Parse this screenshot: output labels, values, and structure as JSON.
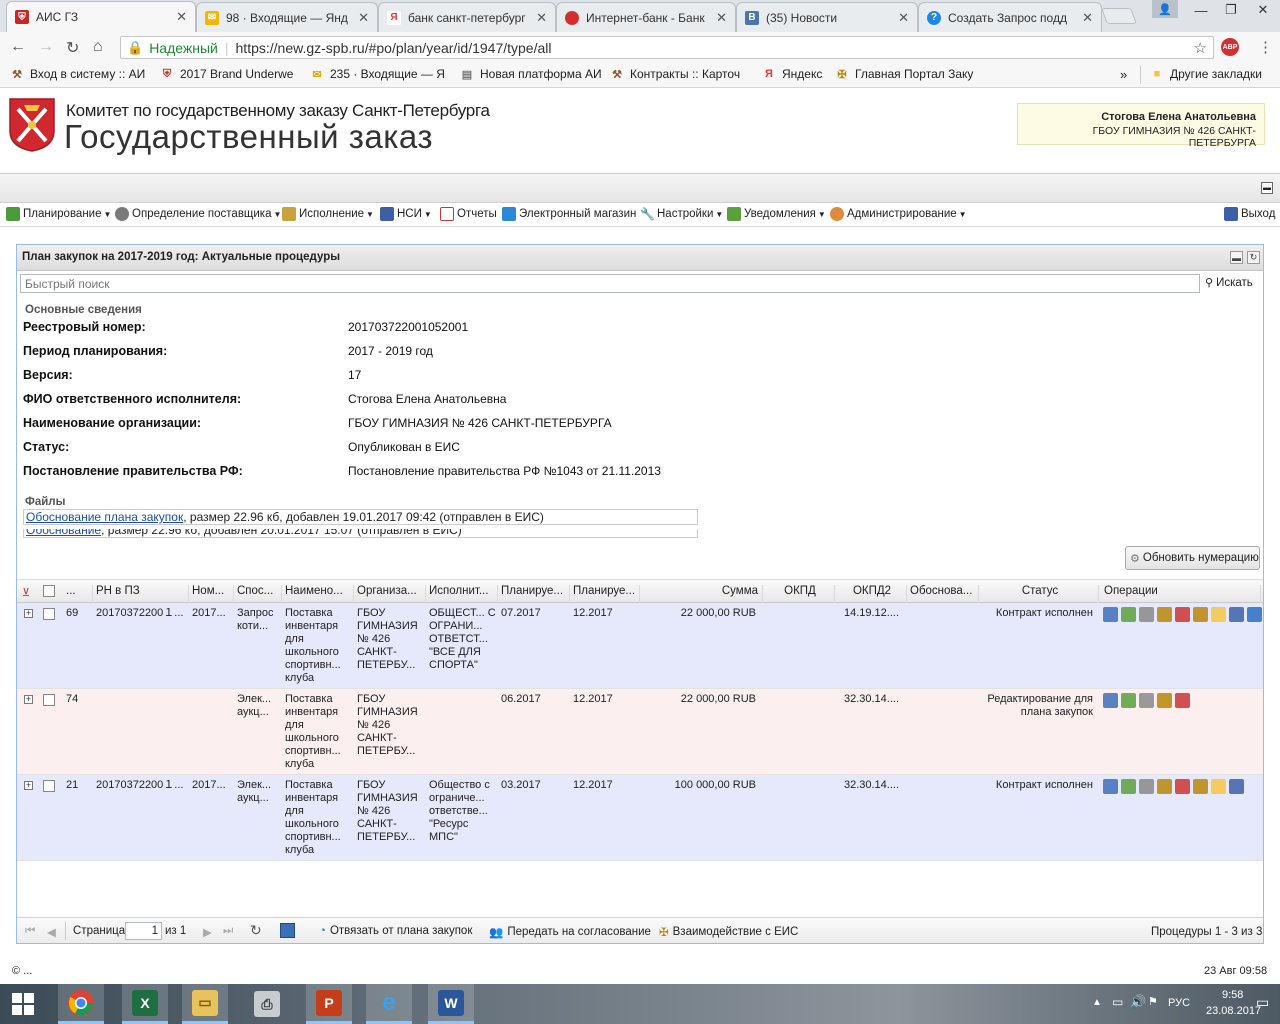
{
  "browser": {
    "tabs": [
      {
        "title": "АИС ГЗ",
        "color": "#c62828",
        "glyph": "⛨",
        "active": true
      },
      {
        "title": "98 · Входящие — Янд",
        "color": "#f2b705",
        "glyph": "✉",
        "active": false
      },
      {
        "title": "банк санкт-петербург",
        "color": "#e53935",
        "glyph": "Я",
        "active": false
      },
      {
        "title": "Интернет-банк - Банк",
        "color": "#d32f2f",
        "glyph": "●",
        "active": false
      },
      {
        "title": "(35) Новости",
        "color": "#4a76a8",
        "glyph": "В",
        "active": false
      },
      {
        "title": "Создать Запрос подд",
        "color": "#1e88e5",
        "glyph": "?",
        "active": false
      }
    ],
    "secure_label": "Надежный",
    "url": "https://new.gz-spb.ru/#po/plan/year/id/1947/type/all",
    "abp_label": "ABP",
    "bookmarks": [
      {
        "label": "Вход в систему :: АИ",
        "icon": "tools-icon"
      },
      {
        "label": "2017 Brand Underwe",
        "icon": "shield-icon"
      },
      {
        "label": "235 · Входящие — Я",
        "icon": "mail-icon"
      },
      {
        "label": "Новая платформа АИ",
        "icon": "doc-icon"
      },
      {
        "label": "Контракты :: Карточ",
        "icon": "tools-icon"
      },
      {
        "label": "Яндекс",
        "icon": "yandex-icon"
      },
      {
        "label": "Главная Портал Заку",
        "icon": "emblem-icon"
      }
    ],
    "more_bookmarks": "»",
    "other_bookmarks": "Другие закладки"
  },
  "header": {
    "org_line": "Комитет по государственному заказу Санкт-Петербурга",
    "title": "Государственный заказ",
    "user_name": "Стогова Елена Анатольевна",
    "user_org": "ГБОУ ГИМНАЗИЯ № 426 САНКТ-ПЕТЕРБУРГА"
  },
  "menu": {
    "items": [
      "Планирование",
      "Определение поставщика",
      "Исполнение",
      "НСИ",
      "Отчеты",
      "Электронный магазин",
      "Настройки",
      "Уведомления",
      "Администрирование"
    ],
    "exit_label": "Выход"
  },
  "panel": {
    "title": "План закупок на 2017-2019 год: Актуальные процедуры",
    "search_placeholder": "Быстрый поиск",
    "search_button": "Искать",
    "section_main": "Основные сведения",
    "fields": [
      {
        "label": "Реестровый номер:",
        "value": "201703722001052001"
      },
      {
        "label": "Период планирования:",
        "value": "2017 - 2019 год"
      },
      {
        "label": "Версия:",
        "value": "17"
      },
      {
        "label": "ФИО ответственного исполнителя:",
        "value": "Стогова Елена Анатольевна"
      },
      {
        "label": "Наименование организации:",
        "value": "ГБОУ ГИМНАЗИЯ № 426 САНКТ-ПЕТЕРБУРГА"
      },
      {
        "label": "Статус:",
        "value": "Опубликован в ЕИС"
      },
      {
        "label": "Постановление правительства РФ:",
        "value": "Постановление правительства РФ №1043 от 21.11.2013"
      }
    ],
    "section_files": "Файлы",
    "files": [
      {
        "link": "Обоснование плана закупок",
        "info": ", размер 22.96 кб, добавлен 19.01.2017 09:42 (отправлен в ЕИС)"
      },
      {
        "link": "Обоснование",
        "info": ", размер 22.96 кб, добавлен 20.01.2017 15:07 (отправлен в ЕИС)"
      }
    ],
    "renumber_button": "Обновить нумерацию"
  },
  "grid": {
    "columns": [
      "...",
      "РН в ПЗ",
      "Ном...",
      "Спос...",
      "Наимено...",
      "Организа...",
      "Исполнит...",
      "Планируе...",
      "Планируе...",
      "Сумма",
      "ОКПД",
      "ОКПД2",
      "Обоснова...",
      "Статус",
      "Операции"
    ],
    "rows": [
      {
        "num": "69",
        "rn": "20170372200１...",
        "nom": "2017...",
        "method": "Запрос коти...",
        "name": "Поставка инвентаря для школьного спортивн... клуба",
        "org": "ГБОУ ГИМНАЗИЯ № 426 САНКТ-ПЕТЕРБУ...",
        "exec": "ОБЩЕСТ... С ОГРАНИ... ОТВЕТСТ... \"ВСЕ ДЛЯ СПОРТА\"",
        "plan1": "07.2017",
        "plan2": "12.2017",
        "sum": "22 000,00 RUB",
        "okpd": "",
        "okpd2": "14.19.12....",
        "basis": "",
        "status": "Контракт исполнен",
        "bg": "#e6e9fb",
        "ops": 9
      },
      {
        "num": "74",
        "rn": "",
        "nom": "",
        "method": "Элек... аукц...",
        "name": "Поставка инвентаря для школьного спортивн... клуба",
        "org": "ГБОУ ГИМНАЗИЯ № 426 САНКТ-ПЕТЕРБУ...",
        "exec": "",
        "plan1": "06.2017",
        "plan2": "12.2017",
        "sum": "22 000,00 RUB",
        "okpd": "",
        "okpd2": "32.30.14....",
        "basis": "",
        "status": "Редактирование для плана закупок",
        "bg": "#fbeff0",
        "ops": 5
      },
      {
        "num": "21",
        "rn": "20170372200１...",
        "nom": "2017...",
        "method": "Элек... аукц...",
        "name": "Поставка инвентаря для школьного спортивн... клуба",
        "org": "ГБОУ ГИМНАЗИЯ № 426 САНКТ-ПЕТЕРБУ...",
        "exec": "Общество с ограниче... ответстве... \"Ресурс МПС\"",
        "plan1": "03.2017",
        "plan2": "12.2017",
        "sum": "100 000,00 RUB",
        "okpd": "",
        "okpd2": "32.30.14....",
        "basis": "",
        "status": "Контракт исполнен",
        "bg": "#e6e9fb",
        "ops": 8
      }
    ]
  },
  "pager": {
    "page_label": "Страница",
    "page_value": "1",
    "of_label": "из 1",
    "unlink": "Отвязать от плана закупок",
    "approve": "Передать на согласование",
    "eis": "Взаимодействие с ЕИС",
    "summary": "Процедуры 1 - 3 из 3"
  },
  "status_bar": {
    "left": "© ...",
    "right": "23 Авг 09:58"
  },
  "taskbar": {
    "lang": "РУС",
    "time": "9:58",
    "date": "23.08.2017",
    "apps": [
      "start",
      "chrome",
      "excel",
      "explorer",
      "printer",
      "powerpoint",
      "ie",
      "word"
    ]
  }
}
